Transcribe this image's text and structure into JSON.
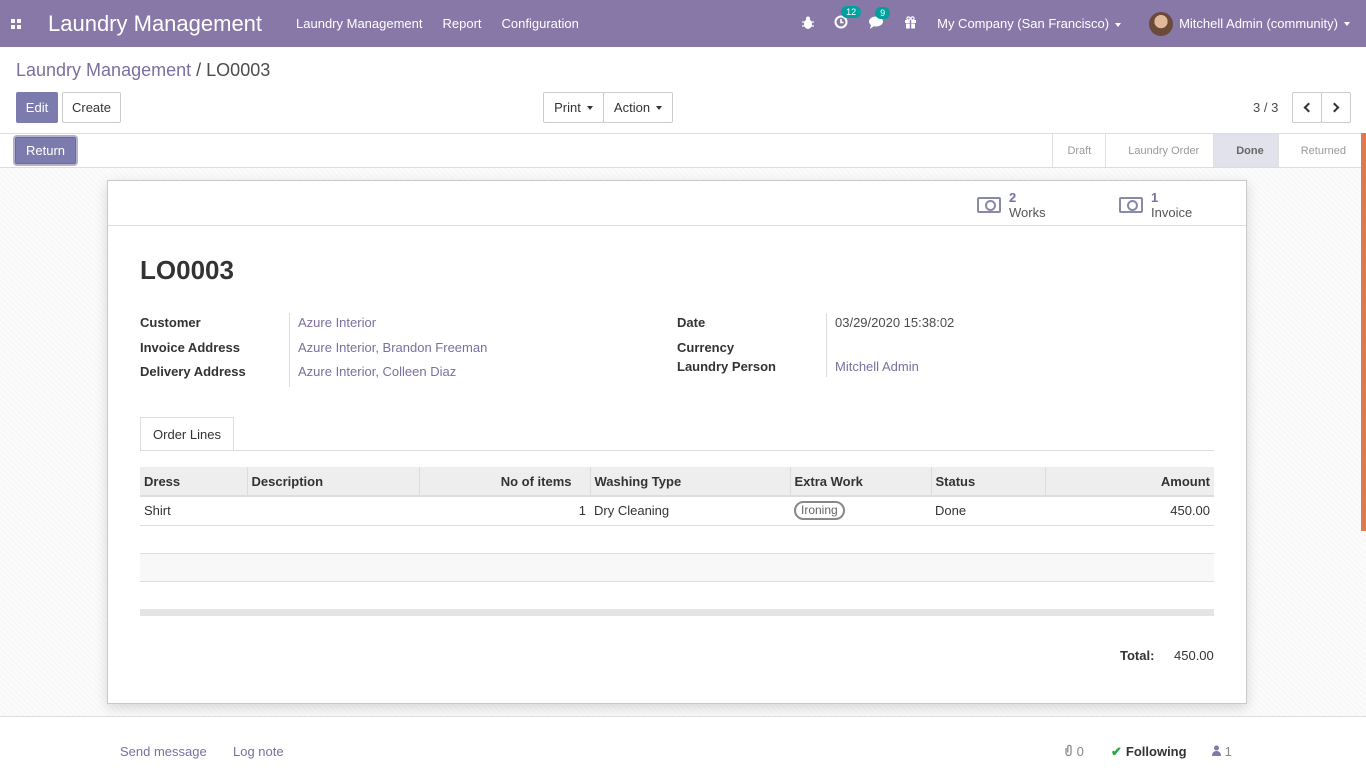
{
  "navbar": {
    "brand": "Laundry Management",
    "menu": [
      "Laundry Management",
      "Report",
      "Configuration"
    ],
    "activity_count": "12",
    "message_count": "9",
    "company": "My Company (San Francisco)",
    "user": "Mitchell Admin (community)"
  },
  "breadcrumb": {
    "parent": "Laundry Management",
    "sep": "/",
    "current": "LO0003"
  },
  "toolbar": {
    "edit": "Edit",
    "create": "Create",
    "print": "Print",
    "action": "Action",
    "pager": "3 / 3"
  },
  "statusbar": {
    "return_label": "Return",
    "stages": [
      "Draft",
      "Laundry Order",
      "Done",
      "Returned"
    ],
    "active_stage": "Done"
  },
  "smart_buttons": [
    {
      "count": "2",
      "label": "Works"
    },
    {
      "count": "1",
      "label": "Invoice"
    }
  ],
  "form": {
    "name": "LO0003",
    "customer_label": "Customer",
    "customer": "Azure Interior",
    "invoice_address_label": "Invoice Address",
    "invoice_address": "Azure Interior, Brandon Freeman",
    "delivery_address_label": "Delivery Address",
    "delivery_address": "Azure Interior, Colleen Diaz",
    "date_label": "Date",
    "date": "03/29/2020 15:38:02",
    "currency_label": "Currency",
    "laundry_person_label": "Laundry Person",
    "laundry_person": "Mitchell Admin"
  },
  "tab": {
    "label": "Order Lines"
  },
  "lines": {
    "headers": [
      "Dress",
      "Description",
      "No of items",
      "Washing Type",
      "Extra Work",
      "Status",
      "Amount"
    ],
    "rows": [
      {
        "dress": "Shirt",
        "description": "",
        "items": "1",
        "washing": "Dry Cleaning",
        "extra": "Ironing",
        "status": "Done",
        "amount": "450.00"
      }
    ]
  },
  "total": {
    "label": "Total:",
    "value": "450.00"
  },
  "chatter": {
    "send": "Send message",
    "log": "Log note",
    "attachments": "0",
    "following": "Following",
    "followers": "1"
  },
  "colors": {
    "primary": "#7c7bad",
    "navbar": "#8778a8",
    "link": "#7c6fa0",
    "success": "#28a745"
  }
}
